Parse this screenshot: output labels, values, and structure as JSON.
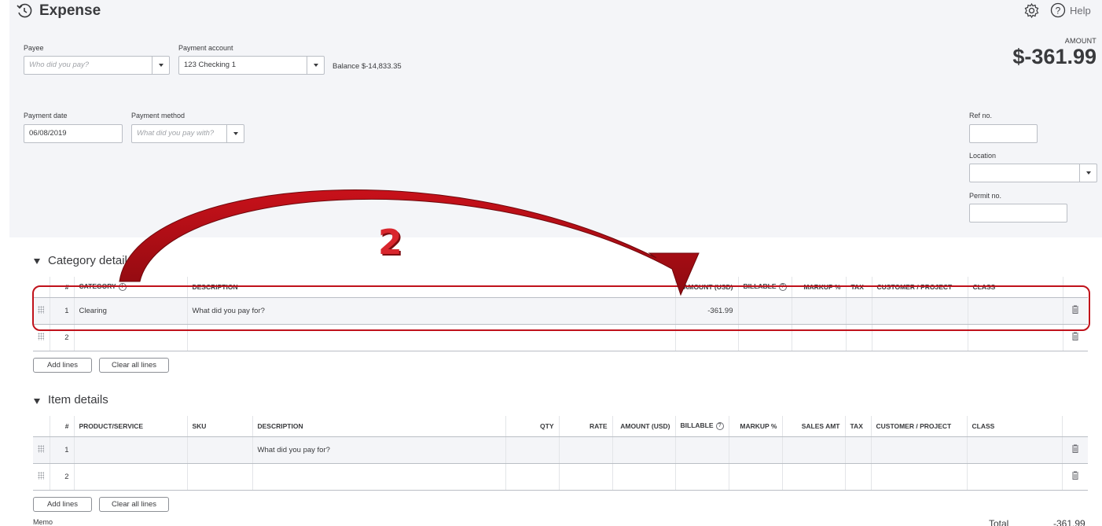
{
  "header": {
    "title": "Expense",
    "help": "Help"
  },
  "form": {
    "payee_label": "Payee",
    "payee_placeholder": "Who did you pay?",
    "account_label": "Payment account",
    "account_value": "123 Checking 1",
    "balance_label": "Balance",
    "balance_value": "$-14,833.35",
    "date_label": "Payment date",
    "date_value": "06/08/2019",
    "method_label": "Payment method",
    "method_placeholder": "What did you pay with?",
    "amount_label": "AMOUNT",
    "amount_value": "$-361.99",
    "ref_label": "Ref no.",
    "location_label": "Location",
    "permit_label": "Permit no."
  },
  "category": {
    "title": "Category details",
    "columns": [
      "#",
      "CATEGORY",
      "DESCRIPTION",
      "AMOUNT (USD)",
      "BILLABLE",
      "MARKUP %",
      "TAX",
      "CUSTOMER / PROJECT",
      "CLASS"
    ],
    "rows": [
      {
        "num": "1",
        "category": "Clearing",
        "description": "What did you pay for?",
        "amount": "-361.99"
      },
      {
        "num": "2",
        "category": "",
        "description": "",
        "amount": ""
      }
    ],
    "add_lines": "Add lines",
    "clear_lines": "Clear all lines"
  },
  "items": {
    "title": "Item details",
    "columns": [
      "#",
      "PRODUCT/SERVICE",
      "SKU",
      "DESCRIPTION",
      "QTY",
      "RATE",
      "AMOUNT (USD)",
      "BILLABLE",
      "MARKUP %",
      "SALES AMT",
      "TAX",
      "CUSTOMER / PROJECT",
      "CLASS"
    ],
    "rows": [
      {
        "num": "1",
        "description": "What did you pay for?"
      },
      {
        "num": "2",
        "description": ""
      }
    ],
    "add_lines": "Add lines",
    "clear_lines": "Clear all lines"
  },
  "footer": {
    "memo_label": "Memo",
    "total_label": "Total",
    "total_value": "-361.99"
  },
  "annotation": {
    "number": "2"
  },
  "colors": {
    "panel": "#f4f5f8",
    "annotation_red": "#c0121b"
  }
}
